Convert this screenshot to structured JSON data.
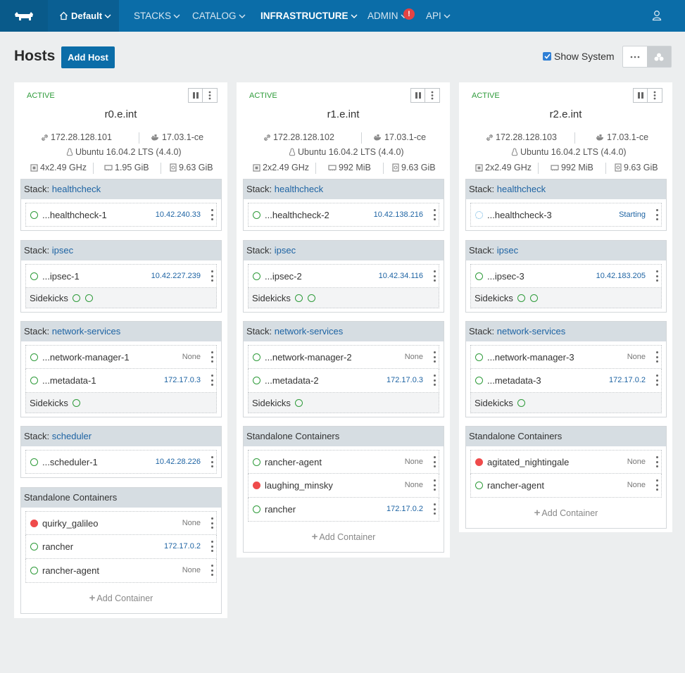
{
  "nav": {
    "environment": "Default",
    "items": [
      "STACKS",
      "CATALOG",
      "INFRASTRUCTURE",
      "ADMIN",
      "API"
    ],
    "alert_badge": "!"
  },
  "header": {
    "title": "Hosts",
    "add_host_label": "Add Host",
    "show_system_label": "Show System",
    "show_system_checked": true
  },
  "hosts": [
    {
      "state": "ACTIVE",
      "name": "r0.e.int",
      "ip": "172.28.128.101",
      "docker": "17.03.1-ce",
      "os": "Ubuntu 16.04.2 LTS (4.4.0)",
      "cpu": "4x2.49 GHz",
      "memory": "1.95 GiB",
      "storage": "9.63 GiB",
      "stacks": [
        {
          "label": "Stack:",
          "name": "healthcheck",
          "containers": [
            {
              "name": "...healthcheck-1",
              "ip": "10.42.240.33",
              "status": "running"
            }
          ]
        },
        {
          "label": "Stack:",
          "name": "ipsec",
          "containers": [
            {
              "name": "...ipsec-1",
              "ip": "10.42.227.239",
              "status": "running"
            }
          ],
          "sidekicks": "Sidekicks"
        },
        {
          "label": "Stack:",
          "name": "network-services",
          "containers": [
            {
              "name": "...network-manager-1",
              "ip": "None",
              "status": "running"
            },
            {
              "name": "...metadata-1",
              "ip": "172.17.0.3",
              "status": "running"
            }
          ],
          "sidekicks": "Sidekicks"
        },
        {
          "label": "Stack:",
          "name": "scheduler",
          "containers": [
            {
              "name": "...scheduler-1",
              "ip": "10.42.28.226",
              "status": "running"
            }
          ]
        }
      ],
      "standalone": {
        "title": "Standalone Containers",
        "containers": [
          {
            "name": "quirky_galileo",
            "ip": "None",
            "status": "stopped"
          },
          {
            "name": "rancher",
            "ip": "172.17.0.2",
            "status": "running"
          },
          {
            "name": "rancher-agent",
            "ip": "None",
            "status": "running"
          }
        ],
        "add_label": "Add Container"
      }
    },
    {
      "state": "ACTIVE",
      "name": "r1.e.int",
      "ip": "172.28.128.102",
      "docker": "17.03.1-ce",
      "os": "Ubuntu 16.04.2 LTS (4.4.0)",
      "cpu": "2x2.49 GHz",
      "memory": "992 MiB",
      "storage": "9.63 GiB",
      "stacks": [
        {
          "label": "Stack:",
          "name": "healthcheck",
          "containers": [
            {
              "name": "...healthcheck-2",
              "ip": "10.42.138.216",
              "status": "running"
            }
          ]
        },
        {
          "label": "Stack:",
          "name": "ipsec",
          "containers": [
            {
              "name": "...ipsec-2",
              "ip": "10.42.34.116",
              "status": "running"
            }
          ],
          "sidekicks": "Sidekicks"
        },
        {
          "label": "Stack:",
          "name": "network-services",
          "containers": [
            {
              "name": "...network-manager-2",
              "ip": "None",
              "status": "running"
            },
            {
              "name": "...metadata-2",
              "ip": "172.17.0.3",
              "status": "running"
            }
          ],
          "sidekicks": "Sidekicks"
        }
      ],
      "standalone": {
        "title": "Standalone Containers",
        "containers": [
          {
            "name": "rancher-agent",
            "ip": "None",
            "status": "running"
          },
          {
            "name": "laughing_minsky",
            "ip": "None",
            "status": "stopped"
          },
          {
            "name": "rancher",
            "ip": "172.17.0.2",
            "status": "running"
          }
        ],
        "add_label": "Add Container"
      }
    },
    {
      "state": "ACTIVE",
      "name": "r2.e.int",
      "ip": "172.28.128.103",
      "docker": "17.03.1-ce",
      "os": "Ubuntu 16.04.2 LTS (4.4.0)",
      "cpu": "2x2.49 GHz",
      "memory": "992 MiB",
      "storage": "9.63 GiB",
      "stacks": [
        {
          "label": "Stack:",
          "name": "healthcheck",
          "containers": [
            {
              "name": "...healthcheck-3",
              "ip": "Starting",
              "status": "starting"
            }
          ]
        },
        {
          "label": "Stack:",
          "name": "ipsec",
          "containers": [
            {
              "name": "...ipsec-3",
              "ip": "10.42.183.205",
              "status": "running"
            }
          ],
          "sidekicks": "Sidekicks"
        },
        {
          "label": "Stack:",
          "name": "network-services",
          "containers": [
            {
              "name": "...network-manager-3",
              "ip": "None",
              "status": "running"
            },
            {
              "name": "...metadata-3",
              "ip": "172.17.0.2",
              "status": "running"
            }
          ],
          "sidekicks": "Sidekicks"
        }
      ],
      "standalone": {
        "title": "Standalone Containers",
        "containers": [
          {
            "name": "agitated_nightingale",
            "ip": "None",
            "status": "stopped"
          },
          {
            "name": "rancher-agent",
            "ip": "None",
            "status": "running"
          }
        ],
        "add_label": "Add Container"
      }
    }
  ],
  "colors": {
    "nav_bg": "#0b6da8",
    "active_green": "#2e9b3a",
    "stopped_red": "#ef4b4b",
    "link_blue": "#1d63a3",
    "panel_header": "#d6dde2"
  }
}
